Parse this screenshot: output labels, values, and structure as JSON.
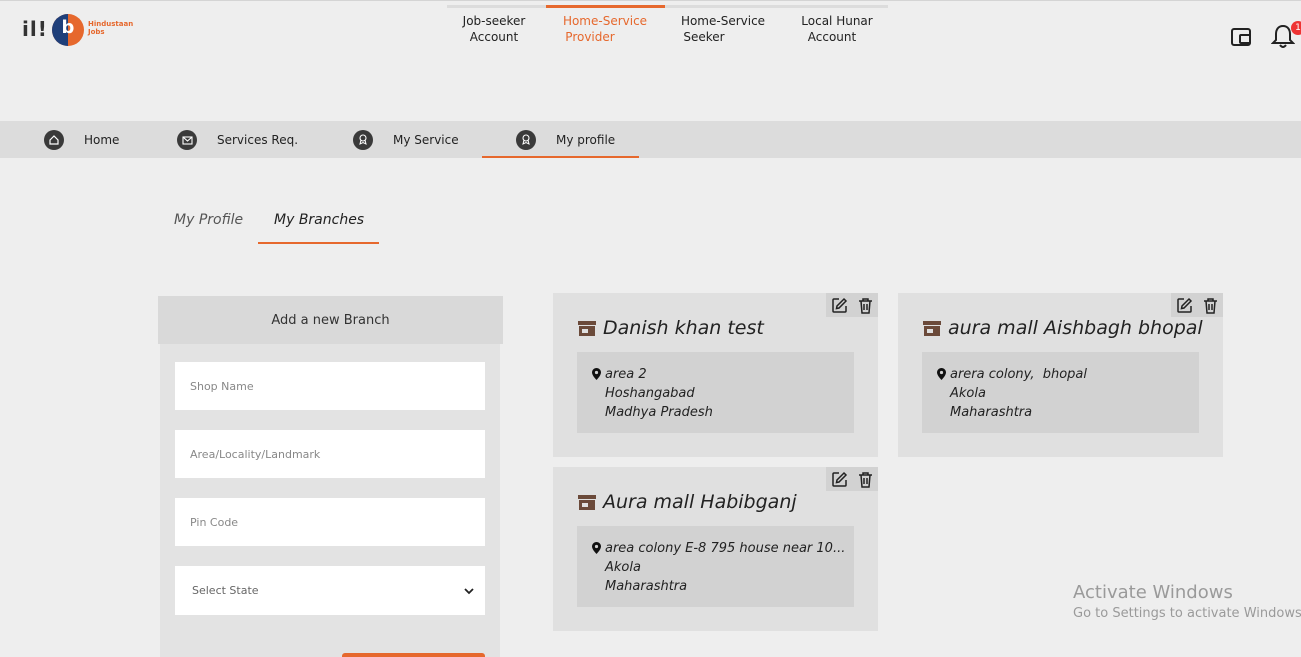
{
  "header": {
    "brand_line1": "Hindustaan",
    "brand_line2": "Jobs",
    "menu_glyph": "il!",
    "account_tabs": [
      {
        "line1": "Job-seeker",
        "line2": "Account"
      },
      {
        "line1": "Home-Service",
        "line2": "Provider"
      },
      {
        "line1": "Home-Service",
        "line2": "Seeker"
      },
      {
        "line1": "Local Hunar",
        "line2": "Account"
      }
    ],
    "active_account_tab": "Home-Service Provider",
    "notification_count": "1",
    "icons": [
      "wallet-icon",
      "bell-icon"
    ]
  },
  "nav": {
    "items": [
      {
        "label": "Home",
        "icon": "home-icon"
      },
      {
        "label": "Services Req.",
        "icon": "mail-icon"
      },
      {
        "label": "My Service",
        "icon": "badge-icon"
      },
      {
        "label": "My profile",
        "icon": "badge-icon"
      }
    ],
    "active": "My profile"
  },
  "sub_tabs": {
    "items": [
      "My Profile",
      "My Branches"
    ],
    "active": "My Branches"
  },
  "add_branch": {
    "title": "Add a new Branch",
    "shop_name_placeholder": "Shop Name",
    "area_placeholder": "Area/Locality/Landmark",
    "pincode_placeholder": "Pin Code",
    "state_select": "Select State"
  },
  "branches": [
    {
      "name": "Danish khan test",
      "area": "area 2",
      "city": "Hoshangabad",
      "state": "Madhya Pradesh"
    },
    {
      "name": "aura mall Aishbagh bhopal",
      "area": "arera colony,  bhopal",
      "city": "Akola",
      "state": "Maharashtra"
    },
    {
      "name": "Aura mall Habibganj",
      "area": "area colony E-8 795 house near 10...",
      "city": "Akola",
      "state": "Maharashtra"
    }
  ],
  "watermark": {
    "line1": "Activate Windows",
    "line2": "Go to Settings to activate Windows."
  },
  "colors": {
    "accent": "#e6682d",
    "background": "#eeeeee",
    "card": "#e0e0e0",
    "card_inner": "#d2d2d2",
    "navbar": "#dcdcdc"
  }
}
